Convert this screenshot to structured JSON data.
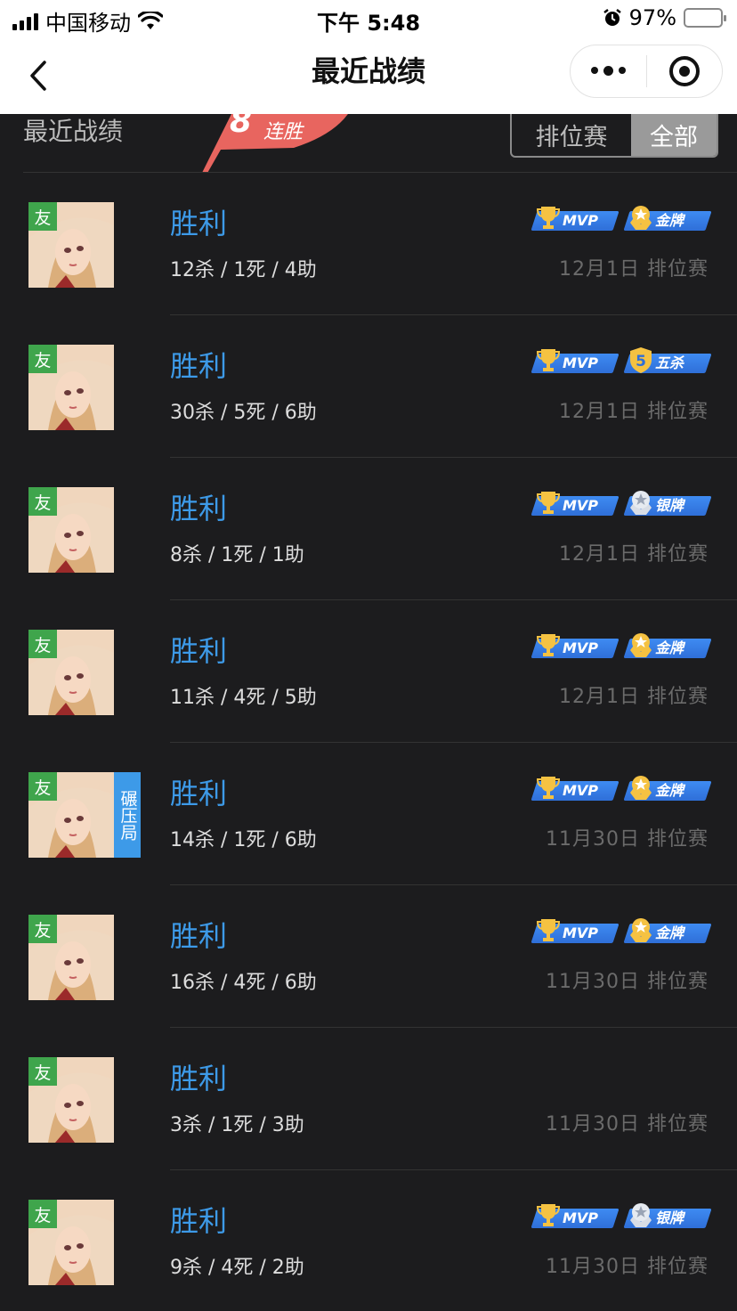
{
  "status_bar": {
    "carrier": "中国移动",
    "time": "下午 5:48",
    "battery": "97%"
  },
  "nav": {
    "title": "最近战绩"
  },
  "header": {
    "section_title": "最近战绩",
    "streak_number": "8",
    "streak_label": "连胜",
    "tabs": [
      "排位赛",
      "全部"
    ],
    "active_tab": "全部"
  },
  "colors": {
    "accent": "#3d9ae8",
    "friend": "#3fa54c",
    "streak": "#e8655f",
    "background": "#1c1c1e"
  },
  "matches": [
    {
      "friend": "友",
      "result": "胜利",
      "kda": "12杀 / 1死 / 4助",
      "date_mode": "12月1日 排位赛",
      "badges": [
        {
          "icon": "trophy-icon",
          "text": "MVP"
        },
        {
          "icon": "gold-medal-icon",
          "text": "金牌"
        }
      ]
    },
    {
      "friend": "友",
      "result": "胜利",
      "kda": "30杀 / 5死 / 6助",
      "date_mode": "12月1日 排位赛",
      "badges": [
        {
          "icon": "trophy-icon",
          "text": "MVP"
        },
        {
          "icon": "penta-kill-icon",
          "text": "五杀"
        }
      ]
    },
    {
      "friend": "友",
      "result": "胜利",
      "kda": "8杀 / 1死 / 1助",
      "date_mode": "12月1日 排位赛",
      "badges": [
        {
          "icon": "trophy-icon",
          "text": "MVP"
        },
        {
          "icon": "silver-medal-icon",
          "text": "银牌"
        }
      ]
    },
    {
      "friend": "友",
      "result": "胜利",
      "kda": "11杀 / 4死 / 5助",
      "date_mode": "12月1日 排位赛",
      "badges": [
        {
          "icon": "trophy-icon",
          "text": "MVP"
        },
        {
          "icon": "gold-medal-icon",
          "text": "金牌"
        }
      ]
    },
    {
      "friend": "友",
      "tag": "碾压局",
      "result": "胜利",
      "kda": "14杀 / 1死 / 6助",
      "date_mode": "11月30日 排位赛",
      "badges": [
        {
          "icon": "trophy-icon",
          "text": "MVP"
        },
        {
          "icon": "gold-medal-icon",
          "text": "金牌"
        }
      ]
    },
    {
      "friend": "友",
      "result": "胜利",
      "kda": "16杀 / 4死 / 6助",
      "date_mode": "11月30日 排位赛",
      "badges": [
        {
          "icon": "trophy-icon",
          "text": "MVP"
        },
        {
          "icon": "gold-medal-icon",
          "text": "金牌"
        }
      ]
    },
    {
      "friend": "友",
      "result": "胜利",
      "kda": "3杀 / 1死 / 3助",
      "date_mode": "11月30日 排位赛",
      "badges": []
    },
    {
      "friend": "友",
      "result": "胜利",
      "kda": "9杀 / 4死 / 2助",
      "date_mode": "11月30日 排位赛",
      "badges": [
        {
          "icon": "trophy-icon",
          "text": "MVP"
        },
        {
          "icon": "silver-medal-icon",
          "text": "银牌"
        }
      ]
    }
  ]
}
